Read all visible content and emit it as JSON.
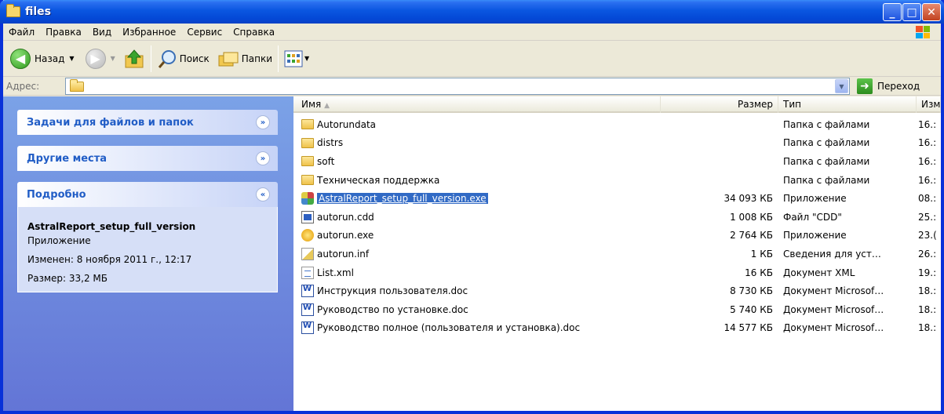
{
  "window": {
    "title": "files"
  },
  "menu": [
    "Файл",
    "Правка",
    "Вид",
    "Избранное",
    "Сервис",
    "Справка"
  ],
  "toolbar": {
    "back": "Назад",
    "search": "Поиск",
    "folders": "Папки"
  },
  "address": {
    "label": "Адрес:",
    "go": "Переход"
  },
  "tasks": {
    "file_tasks": "Задачи для файлов и папок",
    "other_places": "Другие места",
    "details": "Подробно"
  },
  "details": {
    "name": "AstralReport_setup_full_version",
    "type": "Приложение",
    "modified": "Изменен: 8 ноября 2011 г., 12:17",
    "size": "Размер: 33,2 МБ"
  },
  "columns": {
    "name": "Имя",
    "size": "Размер",
    "type": "Тип",
    "date": "Изм"
  },
  "files": [
    {
      "name": "Autorundata",
      "size": "",
      "type": "Папка с файлами",
      "date": "16.:",
      "icon": "folder-icon"
    },
    {
      "name": "distrs",
      "size": "",
      "type": "Папка с файлами",
      "date": "16.:",
      "icon": "folder-icon"
    },
    {
      "name": "soft",
      "size": "",
      "type": "Папка с файлами",
      "date": "16.:",
      "icon": "folder-icon"
    },
    {
      "name": "Техническая поддержка",
      "size": "",
      "type": "Папка с файлами",
      "date": "16.:",
      "icon": "folder-icon"
    },
    {
      "name": "AstralReport_setup_full_version.exe",
      "size": "34 093 КБ",
      "type": "Приложение",
      "date": "08.:",
      "icon": "setup-icon",
      "selected": true
    },
    {
      "name": "autorun.cdd",
      "size": "1 008 КБ",
      "type": "Файл \"CDD\"",
      "date": "25.:",
      "icon": "cdd-icon"
    },
    {
      "name": "autorun.exe",
      "size": "2 764 КБ",
      "type": "Приложение",
      "date": "23.(",
      "icon": "exe-icon"
    },
    {
      "name": "autorun.inf",
      "size": "1 КБ",
      "type": "Сведения для уст…",
      "date": "26.:",
      "icon": "inf-icon"
    },
    {
      "name": "List.xml",
      "size": "16 КБ",
      "type": "Документ XML",
      "date": "19.:",
      "icon": "xml-icon"
    },
    {
      "name": "Инструкция пользователя.doc",
      "size": "8 730 КБ",
      "type": "Документ Microsof…",
      "date": "18.:",
      "icon": "doc-icon"
    },
    {
      "name": "Руководство по установке.doc",
      "size": "5 740 КБ",
      "type": "Документ Microsof…",
      "date": "18.:",
      "icon": "doc-icon"
    },
    {
      "name": "Руководство полное (пользователя и установка).doc",
      "size": "14 577 КБ",
      "type": "Документ Microsof…",
      "date": "18.:",
      "icon": "doc-icon"
    }
  ]
}
